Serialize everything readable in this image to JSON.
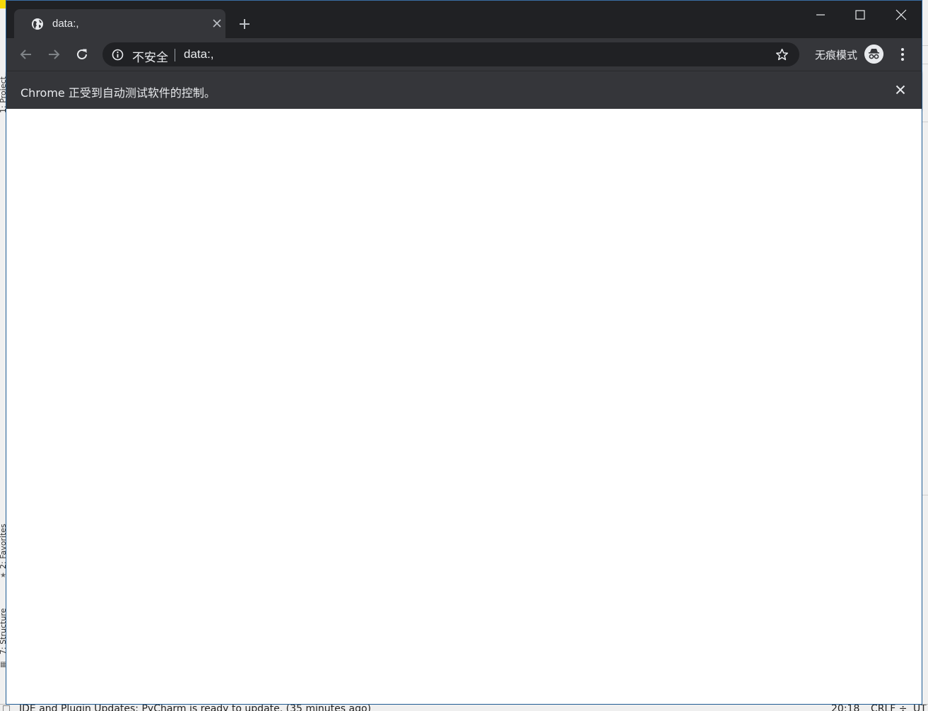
{
  "ide": {
    "sidebar_project": "1: Project",
    "sidebar_favorites": "2: Favorites",
    "sidebar_structure": "7: Structure",
    "status_message": "IDE and Plugin Updates: PyCharm is ready to update. (35 minutes ago)",
    "cursor_position": "20:18",
    "line_separator": "CRLF ÷",
    "encoding": "UT"
  },
  "browser": {
    "tab_title": "data:,",
    "security_label": "不安全",
    "url": "data:,",
    "incognito_label": "无痕模式",
    "infobar_message": "Chrome 正受到自动测试软件的控制。"
  },
  "colors": {
    "titlebar": "#202124",
    "toolbar": "#35363a",
    "text": "#e8eaed",
    "content": "#ffffff"
  }
}
